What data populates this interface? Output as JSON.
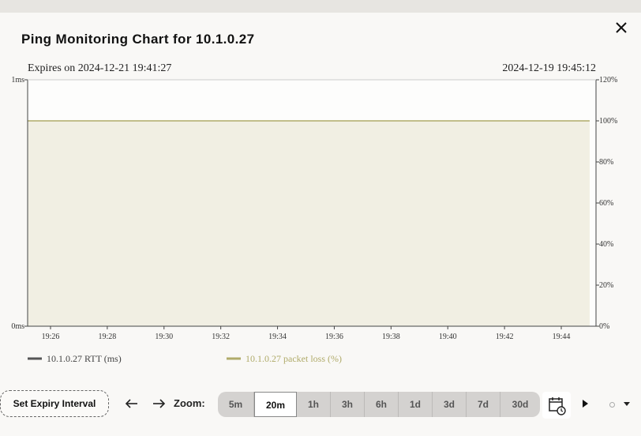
{
  "title": "Ping Monitoring Chart for 10.1.0.27",
  "expires": "Expires on 2024-12-21 19:41:27",
  "timestamp": "2024-12-19 19:45:12",
  "controls": {
    "expiry_button": "Set Expiry Interval",
    "zoom_label": "Zoom:",
    "zoom_options": [
      "5m",
      "20m",
      "1h",
      "3h",
      "6h",
      "1d",
      "3d",
      "7d",
      "30d"
    ],
    "zoom_active": "20m"
  },
  "icons": {
    "close": "close-icon",
    "prev": "arrow-left-icon",
    "next": "arrow-right-icon",
    "calendar": "calendar-clock-icon",
    "play": "play-icon",
    "menu": "chevron-down-icon"
  },
  "colors": {
    "rtt": "#555555",
    "loss": "#b0ab6a",
    "loss_fill": "#f1efe3"
  },
  "chart_data": {
    "type": "line",
    "x_ticks": [
      "19:26",
      "19:28",
      "19:30",
      "19:32",
      "19:34",
      "19:36",
      "19:38",
      "19:40",
      "19:42",
      "19:44"
    ],
    "y_left_ticks": [
      "0ms",
      "1ms"
    ],
    "y_right_ticks": [
      "0%",
      "20%",
      "40%",
      "60%",
      "80%",
      "100%",
      "120%"
    ],
    "ylim_left": [
      0,
      1
    ],
    "ylim_right": [
      0,
      120
    ],
    "series": [
      {
        "name": "10.1.0.27 RTT (ms)",
        "axis": "left",
        "values": []
      },
      {
        "name": "10.1.0.27 packet loss (%)",
        "axis": "right",
        "fill": true,
        "x": [
          "19:25",
          "19:45"
        ],
        "values": [
          100,
          100
        ]
      }
    ],
    "legend_position": "bottom-left",
    "grid": false
  }
}
